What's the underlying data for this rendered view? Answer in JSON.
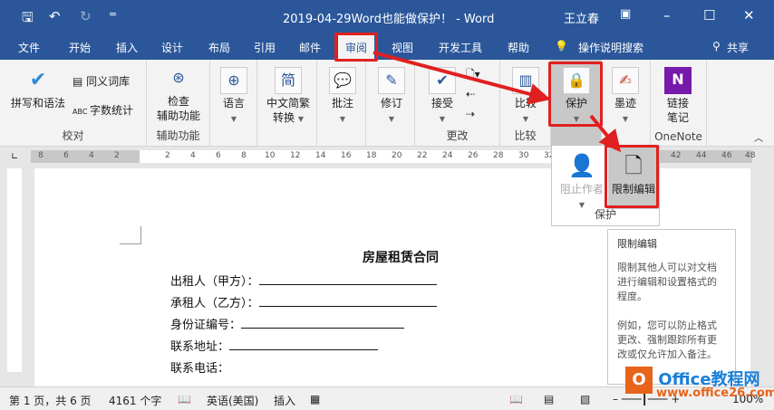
{
  "title_bar": {
    "title": "2019-04-29Word也能做保护！ - Word",
    "user": "王立春",
    "save_icon": "save-icon",
    "undo_icon": "undo-icon",
    "redo_icon": "redo-icon",
    "qa_more": "="
  },
  "tabs": [
    "文件",
    "开始",
    "插入",
    "设计",
    "布局",
    "引用",
    "邮件",
    "审阅",
    "视图",
    "开发工具",
    "帮助"
  ],
  "active_tab": "审阅",
  "search": "操作说明搜索",
  "share": "共享",
  "ribbon": {
    "proofing": {
      "spelling": "拼写和语法",
      "thesaurus": "同义词库",
      "wordcount": "字数统计",
      "label": "校对"
    },
    "accessibility": {
      "check_line1": "检查",
      "check_line2": "辅助功能",
      "label": "辅助功能"
    },
    "language": "语言",
    "chinese_line1": "中文简繁",
    "chinese_line2": "转换",
    "comments": "批注",
    "tracking": "修订",
    "changes": {
      "accept": "接受",
      "label": "更改"
    },
    "compare": {
      "btn": "比较",
      "label": "比较"
    },
    "protect": {
      "btn": "保护"
    },
    "ink": "墨迹",
    "onenote": {
      "line1": "链接",
      "line2": "笔记",
      "label": "OneNote"
    }
  },
  "ruler_left": [
    "8",
    "6",
    "4",
    "2"
  ],
  "ruler_right": [
    "2",
    "4",
    "6",
    "8",
    "10",
    "12",
    "14",
    "16",
    "18",
    "20",
    "22",
    "24",
    "26",
    "28",
    "30",
    "32",
    "42",
    "44",
    "46",
    "48"
  ],
  "protect_menu": {
    "block_authors": "阻止作者",
    "restrict_editing": "限制编辑",
    "label": "保护"
  },
  "tooltip": {
    "title": "限制编辑",
    "p1": "限制其他人可以对文档进行编辑和设置格式的程度。",
    "p2": "例如，您可以防止格式更改、强制跟踪所有更改或仅允许加入备注。"
  },
  "document": {
    "title": "房屋租赁合同",
    "lines": [
      "出租人（甲方）：",
      "承租人（乙方）：",
      "身份证编号：",
      "联系地址：",
      "联系电话："
    ]
  },
  "status": {
    "page": "第 1 页，共 6 页",
    "words": "4161 个字",
    "language": "英语(美国)",
    "mode": "插入",
    "zoom": "100%"
  },
  "watermark": {
    "brand": "Office教程网",
    "url": "www.office26.com"
  },
  "colors": {
    "accent": "#2b579a",
    "highlight": "#e02020"
  }
}
